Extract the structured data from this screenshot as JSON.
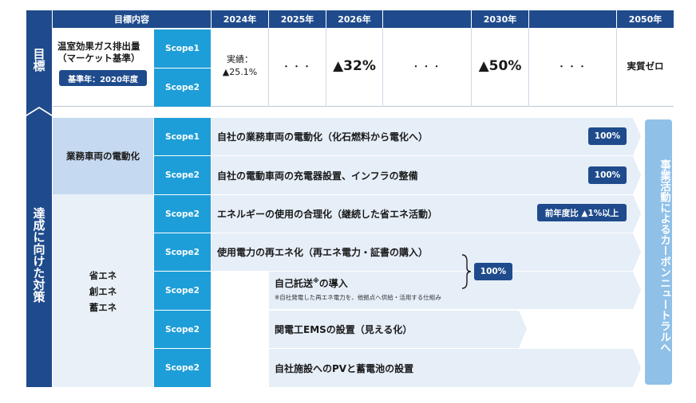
{
  "side_labels": {
    "goal": "目標",
    "actions": "達成に向けた対策"
  },
  "header": {
    "goal_content": "目標内容",
    "years": [
      "2024年",
      "2025年",
      "2026年",
      "",
      "2030年",
      "",
      "2050年"
    ]
  },
  "goal": {
    "title_line1": "温室効果ガス排出量",
    "title_line2": "（マーケット基準）",
    "base_year_badge": "基準年：2020年度",
    "scope1": "Scope1",
    "scope2": "Scope2",
    "actual_label": "実績：",
    "actual_value": "▲25.1%",
    "dots_2025": "・・・",
    "value_2026": "▲32%",
    "dots_2028": "・・・",
    "value_2030": "▲50%",
    "dots_2040": "・・・",
    "value_2050": "実質ゼロ"
  },
  "actions": {
    "group1_label": "業務車両の電動化",
    "group2_labels": [
      "省エネ",
      "創エネ",
      "蓄エネ"
    ],
    "rows": [
      {
        "scope": "Scope1",
        "text": "自社の業務車両の電動化（化石燃料から電化へ）",
        "badge": "100%"
      },
      {
        "scope": "Scope2",
        "text": "自社の電動車両の充電器設置、インフラの整備",
        "badge": "100%"
      },
      {
        "scope": "Scope2",
        "text": "エネルギーの使用の合理化（継続した省エネ活動）",
        "badge": "前年度比 ▲1%以上"
      },
      {
        "scope": "Scope2",
        "text": "使用電力の再エネ化（再エネ電力・証書の購入）",
        "badge": ""
      },
      {
        "scope": "Scope2",
        "text": "自己託送",
        "text_sup": "※",
        "text_suffix": "の導入",
        "note": "※自社発電した再エネ電力を、他拠点へ供給・活用する仕組み",
        "badge": ""
      },
      {
        "scope": "Scope2",
        "text": "関電工EMSの設置（見える化）",
        "badge": ""
      },
      {
        "scope": "Scope2",
        "text": "自社施設へのPVと蓄電池の設置",
        "badge": ""
      }
    ],
    "bracket_badge": "100%",
    "right_banner": "事業活動によるカーボンニュートラルへ"
  }
}
